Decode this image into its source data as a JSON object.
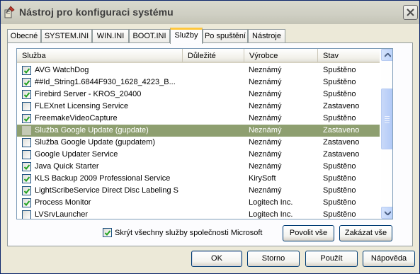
{
  "window": {
    "title": "Nástroj pro konfiguraci systému",
    "close_label": "close"
  },
  "tabs": [
    {
      "label": "Obecné"
    },
    {
      "label": "SYSTEM.INI"
    },
    {
      "label": "WIN.INI"
    },
    {
      "label": "BOOT.INI"
    },
    {
      "label": "Služby"
    },
    {
      "label": "Po spuštění"
    },
    {
      "label": "Nástroje"
    }
  ],
  "active_tab": "Služby",
  "list": {
    "headers": {
      "service": "Služba",
      "important": "Důležité",
      "manufacturer": "Výrobce",
      "status": "Stav"
    },
    "rows": [
      {
        "checked": true,
        "disabled": false,
        "service": "AVG WatchDog",
        "important": "",
        "manufacturer": "Neznámý",
        "status": "Spuštěno"
      },
      {
        "checked": true,
        "disabled": false,
        "service": "##Id_String1.6844F930_1628_4223_B...",
        "important": "",
        "manufacturer": "Neznámý",
        "status": "Spuštěno"
      },
      {
        "checked": true,
        "disabled": false,
        "service": "Firebird Server - KROS_20400",
        "important": "",
        "manufacturer": "Neznámý",
        "status": "Spuštěno"
      },
      {
        "checked": false,
        "disabled": false,
        "service": "FLEXnet Licensing Service",
        "important": "",
        "manufacturer": "Neznámý",
        "status": "Zastaveno"
      },
      {
        "checked": true,
        "disabled": false,
        "service": "FreemakeVideoCapture",
        "important": "",
        "manufacturer": "Neznámý",
        "status": "Spuštěno"
      },
      {
        "checked": false,
        "disabled": true,
        "service": "Služba Google Update (gupdate)",
        "important": "",
        "manufacturer": "Neznámý",
        "status": "Zastaveno",
        "selected": true
      },
      {
        "checked": false,
        "disabled": false,
        "service": "Služba Google Update (gupdatem)",
        "important": "",
        "manufacturer": "Neznámý",
        "status": "Zastaveno"
      },
      {
        "checked": false,
        "disabled": false,
        "service": "Google Updater Service",
        "important": "",
        "manufacturer": "Neznámý",
        "status": "Zastaveno"
      },
      {
        "checked": true,
        "disabled": false,
        "service": "Java Quick Starter",
        "important": "",
        "manufacturer": "Neznámý",
        "status": "Spuštěno"
      },
      {
        "checked": true,
        "disabled": false,
        "service": "KLS Backup 2009 Professional Service",
        "important": "",
        "manufacturer": "KirySoft",
        "status": "Spuštěno"
      },
      {
        "checked": true,
        "disabled": false,
        "service": "LightScribeService Direct Disc Labeling S...",
        "important": "",
        "manufacturer": "Neznámý",
        "status": "Spuštěno"
      },
      {
        "checked": true,
        "disabled": false,
        "service": "Process Monitor",
        "important": "",
        "manufacturer": "Logitech Inc.",
        "status": "Spuštěno"
      },
      {
        "checked": false,
        "disabled": false,
        "service": "LVSrvLauncher",
        "important": "",
        "manufacturer": "Logitech Inc.",
        "status": "Spuštěno"
      }
    ]
  },
  "hide_microsoft": {
    "checked": true,
    "label": "Skrýt všechny služby společnosti Microsoft"
  },
  "buttons": {
    "enable_all": "Povolit vše",
    "disable_all": "Zakázat vše",
    "ok": "OK",
    "cancel": "Storno",
    "apply": "Použít",
    "help": "Nápověda"
  },
  "colors": {
    "selection": "#8e9f70",
    "tab_accent": "#ffc73c",
    "check": "#21a121"
  }
}
